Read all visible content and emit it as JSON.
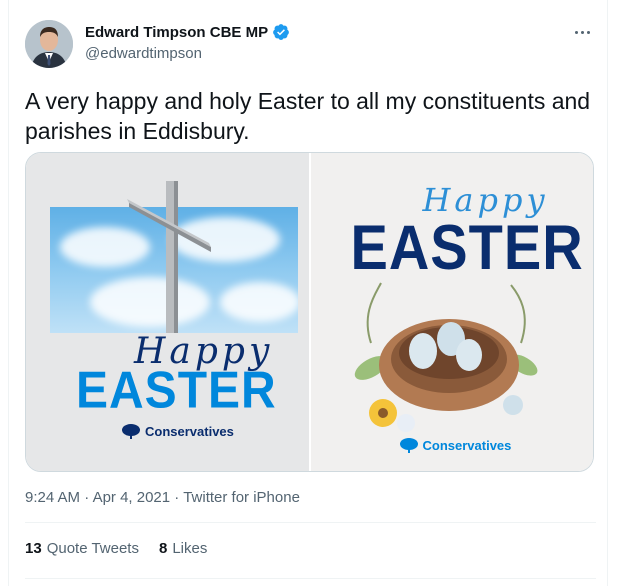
{
  "author": {
    "display_name": "Edward Timpson CBE MP",
    "handle": "@edwardtimpson"
  },
  "more_icon": "more-horizontal-icon",
  "verified_icon": "verified-badge-icon",
  "tweet": {
    "text": "A very happy and holy Easter to all my constituents and parishes in Eddisbury."
  },
  "media": {
    "left": {
      "script": "Happy",
      "word": "EASTER",
      "logo": "Conservatives"
    },
    "right": {
      "script": "Happy",
      "word": "EASTER",
      "logo": "Conservatives"
    }
  },
  "meta": {
    "time": "9:24 AM",
    "sep1": "·",
    "date": "Apr 4, 2021",
    "sep2": "·",
    "source": "Twitter for iPhone"
  },
  "stats": {
    "quote_count": "13",
    "quote_label": "Quote Tweets",
    "like_count": "8",
    "like_label": "Likes"
  },
  "colors": {
    "brand_blue": "#0087dc",
    "navy": "#0a2d6e",
    "verified_blue": "#1d9bf0"
  }
}
